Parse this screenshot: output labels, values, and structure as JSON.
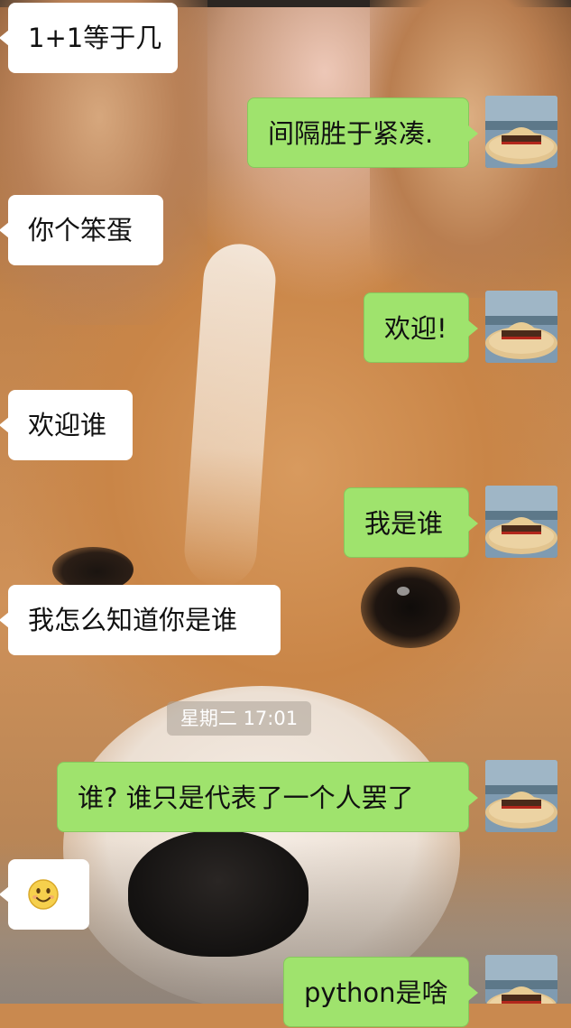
{
  "messages": [
    {
      "side": "in",
      "text": "1+1等于几"
    },
    {
      "side": "out",
      "text": "间隔胜于紧凑."
    },
    {
      "side": "in",
      "text": "你个笨蛋"
    },
    {
      "side": "out",
      "text": "欢迎!"
    },
    {
      "side": "in",
      "text": "欢迎谁"
    },
    {
      "side": "out",
      "text": "我是谁"
    },
    {
      "side": "in",
      "text": "我怎么知道你是谁"
    },
    {
      "side": "out",
      "text": "谁? 谁只是代表了一个人罢了"
    },
    {
      "side": "in",
      "text": "",
      "emoji": "smile-emoji"
    },
    {
      "side": "out",
      "text": "python是啥"
    }
  ],
  "timestamp": "星期二 17:01",
  "avatar": {
    "icon": "straw-hat-avatar"
  },
  "colors": {
    "outgoing_bubble": "#9fe36d",
    "incoming_bubble": "#ffffff",
    "timestamp_bg": "#aaa096"
  }
}
